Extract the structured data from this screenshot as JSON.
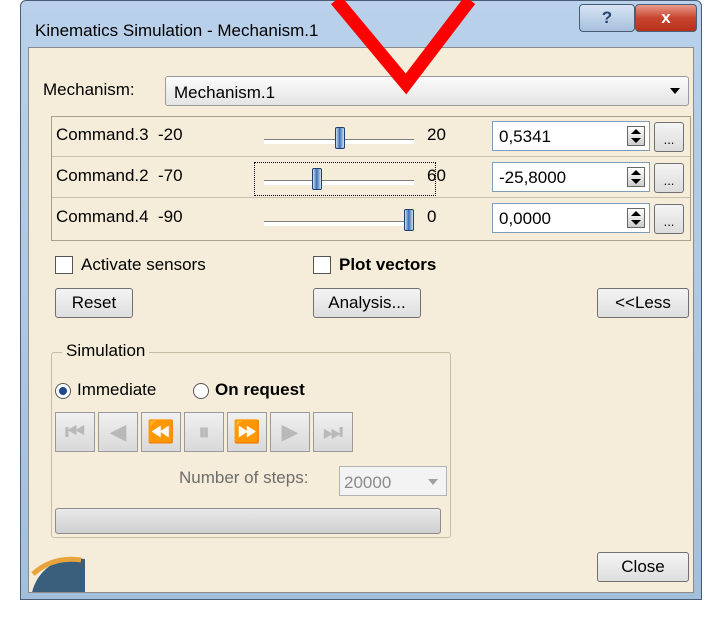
{
  "window": {
    "title": "Kinematics Simulation - Mechanism.1",
    "help_label": "?",
    "close_label": "x"
  },
  "mechanism": {
    "label": "Mechanism:",
    "selected": "Mechanism.1"
  },
  "commands": [
    {
      "name": "Command.3",
      "min": "-20",
      "max": "20",
      "value": "0,5341",
      "slider_fraction": 0.51,
      "dots": "..."
    },
    {
      "name": "Command.2",
      "min": "-70",
      "max": "60",
      "value": "-25,8000",
      "slider_fraction": 0.34,
      "dots": "..."
    },
    {
      "name": "Command.4",
      "min": "-90",
      "max": "0",
      "value": "0,0000",
      "slider_fraction": 1.0,
      "dots": "..."
    }
  ],
  "options": {
    "activate_sensors": "Activate sensors",
    "plot_vectors": "Plot vectors"
  },
  "buttons": {
    "reset": "Reset",
    "analysis": "Analysis...",
    "less": "<<Less",
    "close": "Close"
  },
  "simulation": {
    "group_title": "Simulation",
    "immediate": "Immediate",
    "on_request": "On request",
    "steps_label": "Number of steps:",
    "steps_value": "20000"
  },
  "icons": {
    "annotation": "red-v-mark"
  },
  "colors": {
    "annotation": "#ff0000",
    "client_bg": "#f5ecd9"
  }
}
